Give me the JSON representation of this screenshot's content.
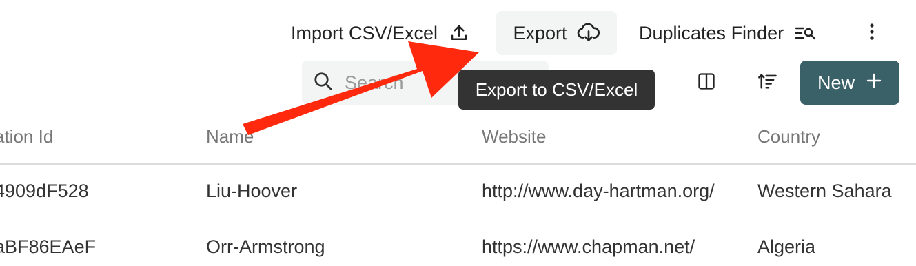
{
  "toolbar": {
    "import_label": "Import CSV/Excel",
    "export_label": "Export",
    "duplicates_label": "Duplicates Finder"
  },
  "search": {
    "placeholder": "Search"
  },
  "new_button": {
    "label": "New"
  },
  "tooltip": {
    "text": "Export to CSV/Excel"
  },
  "table": {
    "columns": [
      "ation Id",
      "Name",
      "Website",
      "Country"
    ],
    "rows": [
      [
        "4909dF528",
        "Liu-Hoover",
        "http://www.day-hartman.org/",
        "Western Sahara"
      ],
      [
        "aBF86EAeF",
        "Orr-Armstrong",
        "https://www.chapman.net/",
        "Algeria"
      ]
    ]
  },
  "colors": {
    "accent": "#3a6068",
    "annotation_arrow": "#ff2a0d",
    "tooltip_bg": "#333333"
  },
  "icons": [
    "upload-icon",
    "cloud-download-icon",
    "duplicates-search-icon",
    "more-vertical-icon",
    "search-icon",
    "columns-icon",
    "sort-icon",
    "plus-icon"
  ]
}
